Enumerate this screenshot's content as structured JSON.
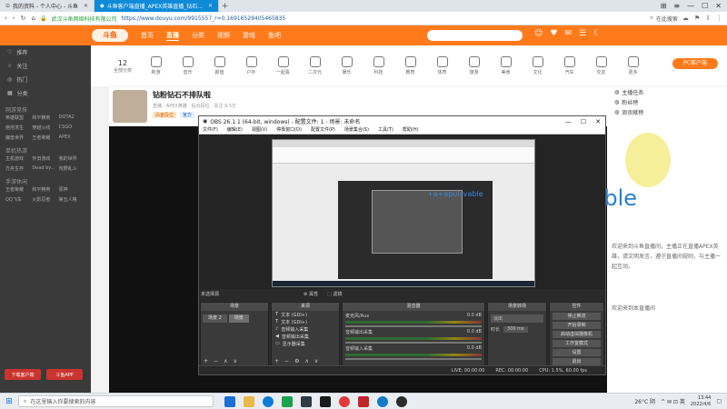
{
  "browser": {
    "tabs": [
      {
        "label": "我的资料 - 个人中心 - 斗鱼",
        "active": false
      },
      {
        "label": "斗鱼客户端直播_APEX英雄直播_钻石...",
        "active": true
      }
    ],
    "new_tab": "+",
    "tab_tools": [
      "⊞",
      "≡"
    ],
    "window_controls": [
      "—",
      "☐",
      "✕"
    ],
    "site_tag": "武汉斗鱼网络科技有限公司",
    "url": "https://www.douyu.com/9915557_r=0.16916529405465835",
    "search_placeholder": "在此搜索",
    "addr_icons": [
      "‹",
      "›",
      "↻",
      "⌂"
    ]
  },
  "douyu": {
    "logo": "斗鱼",
    "nav": [
      {
        "label": "首页",
        "active": false
      },
      {
        "label": "直播",
        "active": true
      },
      {
        "label": "分类",
        "active": false
      },
      {
        "label": "视频",
        "active": false
      },
      {
        "label": "游戏",
        "active": false
      },
      {
        "label": "鱼吧",
        "active": false
      }
    ],
    "header_icons": [
      "☺",
      "♥",
      "✉",
      "☰",
      "☾"
    ],
    "sidebar": {
      "items": [
        "推荐",
        "关注",
        "热门",
        "分类"
      ],
      "sections": [
        {
          "title": "网游竞技",
          "items": [
            "英雄联盟",
            "和平精英",
            "DOTA2",
            "绝地求生",
            "穿越火线",
            "CSGO",
            "魔兽世界",
            "王者荣耀",
            "APEX"
          ]
        },
        {
          "title": "单机热游",
          "items": [
            "主机游戏",
            "怀旧游戏",
            "我的世界",
            "方舟生存",
            "Dead by...",
            "荒野乱斗"
          ]
        },
        {
          "title": "手游休闲",
          "items": [
            "王者荣耀",
            "和平精英",
            "原神",
            "QQ飞车",
            "火影忍者",
            "第五人格"
          ]
        }
      ],
      "btns": [
        "下载客户端",
        "斗鱼APP"
      ]
    },
    "catbar": {
      "count": "12",
      "count_label": "全部分类",
      "items": [
        "新游",
        "音乐",
        "颜值",
        "户外",
        "一起看",
        "二次元",
        "娱乐",
        "科技",
        "教育",
        "体育",
        "旅游",
        "美食",
        "文化",
        "汽车",
        "交友",
        "更多"
      ]
    },
    "pc_button": "PC客户端",
    "room": {
      "title": "钻粉钻石不排队啦",
      "meta": "直播 · APEX英雄 · 钻石段位 · 关注 9.3万",
      "tags": [
        "白金段位",
        "官方"
      ]
    },
    "right_panel": {
      "items": [
        "主播任务",
        "粉丝榜",
        "周贡献榜"
      ],
      "text": "欢迎来到斗鱼直播间，主播正在直播APEX英雄，请文明发言，遵守直播间规则，与主播一起互动。",
      "bottom": "欢迎来到本直播间"
    },
    "overlay": "段位+apulsvable"
  },
  "obs": {
    "title": "OBS 26.1.1 (64-bit, windows) - 配置文件: 1 - 场景: 未命名",
    "menu": [
      "文件(F)",
      "编辑(E)",
      "视图(V)",
      "停靠窗口(D)",
      "配置文件(P)",
      "场景集合(S)",
      "工具(T)",
      "帮助(H)"
    ],
    "controls": [
      "—",
      "☐",
      "✕"
    ],
    "preview_text": "+a+apulsvable",
    "scene_label": "未选择源",
    "toolbar": [
      "⚙ 属性",
      "⬚ 滤镜"
    ],
    "docks": {
      "scenes": {
        "title": "场景",
        "items": [
          "场景 2",
          "场景"
        ]
      },
      "sources": {
        "title": "来源",
        "items": [
          "文本 (GDI+)",
          "文本 (GDI+)",
          "音频输入采集",
          "音频输出采集",
          "显示器采集"
        ]
      },
      "mixer": {
        "title": "混音器",
        "items": [
          {
            "name": "麦克风/Aux",
            "db": "0.0 dB"
          },
          {
            "name": "音频输出采集",
            "db": "0.0 dB"
          },
          {
            "name": "音频输入采集",
            "db": "0.0 dB"
          }
        ]
      },
      "transitions": {
        "title": "场景转场",
        "type": "淡出",
        "duration_label": "时长",
        "duration": "300 ms"
      },
      "controls": {
        "title": "控件",
        "buttons": [
          "停止推流",
          "开始录制",
          "启动虚拟摄像机",
          "工作室模式",
          "设置",
          "退出"
        ]
      }
    },
    "status": [
      "LIVE: 00:00:00",
      "REC: 00:00:00",
      "CPU: 1.5%, 60.00 fps"
    ]
  },
  "taskbar": {
    "search_placeholder": "在这里输入你要搜索的内容",
    "apps": [
      "#1b6fd4",
      "#3a3a3a",
      "#0f7bd8",
      "#1aa34a",
      "#2f3a46",
      "#1a1a1a",
      "#e33b3b",
      "#c2252b",
      "#1479c7",
      "#2b2b2b"
    ],
    "weather": "26°C 阴",
    "tray": "^  ✉  ⊡  英",
    "time": "13:44",
    "date": "2022/4/6"
  }
}
